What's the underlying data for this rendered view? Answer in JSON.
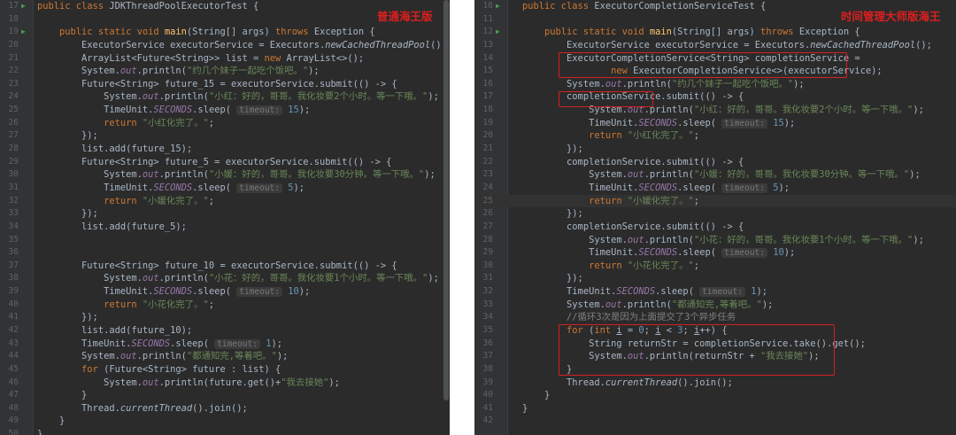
{
  "left": {
    "annotation": "普通海王版",
    "lines": [
      {
        "n": "17",
        "h": "<span class=\"kw\">public class </span>JDKThreadPoolExecutorTest {"
      },
      {
        "n": "18",
        "h": ""
      },
      {
        "n": "19",
        "h": "    <span class=\"kw\">public static void </span><span class=\"fn\">main</span>(String[] args) <span class=\"kw\">throws </span>Exception {"
      },
      {
        "n": "20",
        "h": "        ExecutorService executorService = Executors.<span class=\"it\">newCachedThreadPool</span>();"
      },
      {
        "n": "21",
        "h": "        ArrayList&lt;Future&lt;String&gt;&gt; list = <span class=\"kw\">new </span>ArrayList&lt;&gt;();"
      },
      {
        "n": "22",
        "h": "        System.<span class=\"st\">out</span>.println(<span class=\"str\">\"约几个妹子一起吃个饭吧。\"</span>);"
      },
      {
        "n": "23",
        "h": "        Future&lt;String&gt; future_15 = executorService.submit(() -&gt; {"
      },
      {
        "n": "24",
        "h": "            System.<span class=\"st\">out</span>.println(<span class=\"str\">\"小红：好的，哥哥。我化妆要2个小时。等一下哦。\"</span>);"
      },
      {
        "n": "25",
        "h": "            TimeUnit.<span class=\"st\">SECONDS</span>.sleep( <span class=\"hint\">timeout:</span> <span class=\"num\">15</span>);"
      },
      {
        "n": "26",
        "h": "            <span class=\"kw\">return </span><span class=\"str\">\"小红化完了。\"</span>;"
      },
      {
        "n": "27",
        "h": "        });"
      },
      {
        "n": "28",
        "h": "        list.add(future_15);"
      },
      {
        "n": "29",
        "h": "        Future&lt;String&gt; future_5 = executorService.submit(() -&gt; {"
      },
      {
        "n": "30",
        "h": "            System.<span class=\"st\">out</span>.println(<span class=\"str\">\"小媛：好的，哥哥。我化妆要30分钟。等一下哦。\"</span>);"
      },
      {
        "n": "31",
        "h": "            TimeUnit.<span class=\"st\">SECONDS</span>.sleep( <span class=\"hint\">timeout:</span> <span class=\"num\">5</span>);"
      },
      {
        "n": "32",
        "h": "            <span class=\"kw\">return </span><span class=\"str\">\"小媛化完了。\"</span>;"
      },
      {
        "n": "33",
        "h": "        });"
      },
      {
        "n": "34",
        "h": "        list.add(future_5);"
      },
      {
        "n": "35",
        "h": ""
      },
      {
        "n": "36",
        "h": ""
      },
      {
        "n": "37",
        "h": "        Future&lt;String&gt; future_10 = executorService.submit(() -&gt; {"
      },
      {
        "n": "38",
        "h": "            System.<span class=\"st\">out</span>.println(<span class=\"str\">\"小花：好的，哥哥。我化妆要1个小时。等一下哦。\"</span>);"
      },
      {
        "n": "39",
        "h": "            TimeUnit.<span class=\"st\">SECONDS</span>.sleep( <span class=\"hint\">timeout:</span> <span class=\"num\">10</span>);"
      },
      {
        "n": "40",
        "h": "            <span class=\"kw\">return </span><span class=\"str\">\"小花化完了。\"</span>;"
      },
      {
        "n": "41",
        "h": "        });"
      },
      {
        "n": "42",
        "h": "        list.add(future_10);"
      },
      {
        "n": "43",
        "h": "        TimeUnit.<span class=\"st\">SECONDS</span>.sleep( <span class=\"hint\">timeout:</span> <span class=\"num\">1</span>);"
      },
      {
        "n": "44",
        "h": "        System.<span class=\"st\">out</span>.println(<span class=\"str\">\"都通知完,等着吧。\"</span>);"
      },
      {
        "n": "45",
        "h": "        <span class=\"kw\">for </span>(Future&lt;String&gt; future : list) {"
      },
      {
        "n": "46",
        "h": "            System.<span class=\"st\">out</span>.println(future.get()+<span class=\"str\">\"我去接她\"</span>);"
      },
      {
        "n": "47",
        "h": "        }"
      },
      {
        "n": "48",
        "h": "        Thread.<span class=\"it\">currentThread</span>().join();"
      },
      {
        "n": "49",
        "h": "    }"
      },
      {
        "n": "50",
        "h": "}"
      }
    ]
  },
  "right": {
    "annotation": "时间管理大师版海王",
    "lines": [
      {
        "n": "10",
        "h": "<span class=\"kw\">public class </span>ExecutorCompletionServiceTest {"
      },
      {
        "n": "11",
        "h": ""
      },
      {
        "n": "12",
        "h": "    <span class=\"kw\">public static void </span><span class=\"fn\">main</span>(String[] args) <span class=\"kw\">throws </span>Exception {"
      },
      {
        "n": "13",
        "h": "        ExecutorService executorService = Executors.<span class=\"it\">newCachedThreadPool</span>();"
      },
      {
        "n": "14",
        "h": "        ExecutorCompletionService&lt;String&gt; completionService ="
      },
      {
        "n": "15",
        "h": "                <span class=\"kw\">new </span>ExecutorCompletionService&lt;&gt;(executorService);"
      },
      {
        "n": "16",
        "h": "        System.<span class=\"st\">out</span>.println(<span class=\"str\">\"约几个妹子一起吃个饭吧。\"</span>);"
      },
      {
        "n": "17",
        "h": "        completionService.submit(() -&gt; {"
      },
      {
        "n": "18",
        "h": "            System.<span class=\"st\">out</span>.println(<span class=\"str\">\"小红：好的，哥哥。我化妆要2个小时。等一下哦。\"</span>);"
      },
      {
        "n": "19",
        "h": "            TimeUnit.<span class=\"st\">SECONDS</span>.sleep( <span class=\"hint\">timeout:</span> <span class=\"num\">15</span>);"
      },
      {
        "n": "20",
        "h": "            <span class=\"kw\">return </span><span class=\"str\">\"小红化完了。\"</span>;"
      },
      {
        "n": "21",
        "h": "        });"
      },
      {
        "n": "22",
        "h": "        completionService.submit(() -&gt; {"
      },
      {
        "n": "23",
        "h": "            System.<span class=\"st\">out</span>.println(<span class=\"str\">\"小媛：好的，哥哥。我化妆要30分钟。等一下哦。\"</span>);"
      },
      {
        "n": "24",
        "h": "            TimeUnit.<span class=\"st\">SECONDS</span>.sleep( <span class=\"hint\">timeout:</span> <span class=\"num\">5</span>);"
      },
      {
        "n": "25",
        "h": "            <span class=\"kw\">return </span><span class=\"str\">\"小媛化完了。\"</span>;"
      },
      {
        "n": "26",
        "h": "        });"
      },
      {
        "n": "27",
        "h": "        completionService.submit(() -&gt; {"
      },
      {
        "n": "28",
        "h": "            System.<span class=\"st\">out</span>.println(<span class=\"str\">\"小花：好的，哥哥。我化妆要1个小时。等一下哦。\"</span>);"
      },
      {
        "n": "29",
        "h": "            TimeUnit.<span class=\"st\">SECONDS</span>.sleep( <span class=\"hint\">timeout:</span> <span class=\"num\">10</span>);"
      },
      {
        "n": "30",
        "h": "            <span class=\"kw\">return </span><span class=\"str\">\"小花化完了。\"</span>;"
      },
      {
        "n": "31",
        "h": "        });"
      },
      {
        "n": "32",
        "h": "        TimeUnit.<span class=\"st\">SECONDS</span>.sleep( <span class=\"hint\">timeout:</span> <span class=\"num\">1</span>);"
      },
      {
        "n": "33",
        "h": "        System.<span class=\"st\">out</span>.println(<span class=\"str\">\"都通知完,等着吧。\"</span>);"
      },
      {
        "n": "34",
        "h": "        <span class=\"cm\">//循环3次是因为上面提交了3个异步任务</span>"
      },
      {
        "n": "35",
        "h": "        <span class=\"kw\">for </span>(<span class=\"kw\">int </span><u>i</u> = <span class=\"num\">0</span>; <u>i</u> &lt; <span class=\"num\">3</span>; <u>i</u>++) {"
      },
      {
        "n": "36",
        "h": "            String returnStr = completionService.take().get();"
      },
      {
        "n": "37",
        "h": "            System.<span class=\"st\">out</span>.println(returnStr + <span class=\"str\">\"我去接她\"</span>);"
      },
      {
        "n": "38",
        "h": "        }"
      },
      {
        "n": "39",
        "h": "        Thread.<span class=\"it\">currentThread</span>().join();"
      },
      {
        "n": "40",
        "h": "    }"
      },
      {
        "n": "41",
        "h": "}"
      },
      {
        "n": "42",
        "h": ""
      }
    ]
  }
}
